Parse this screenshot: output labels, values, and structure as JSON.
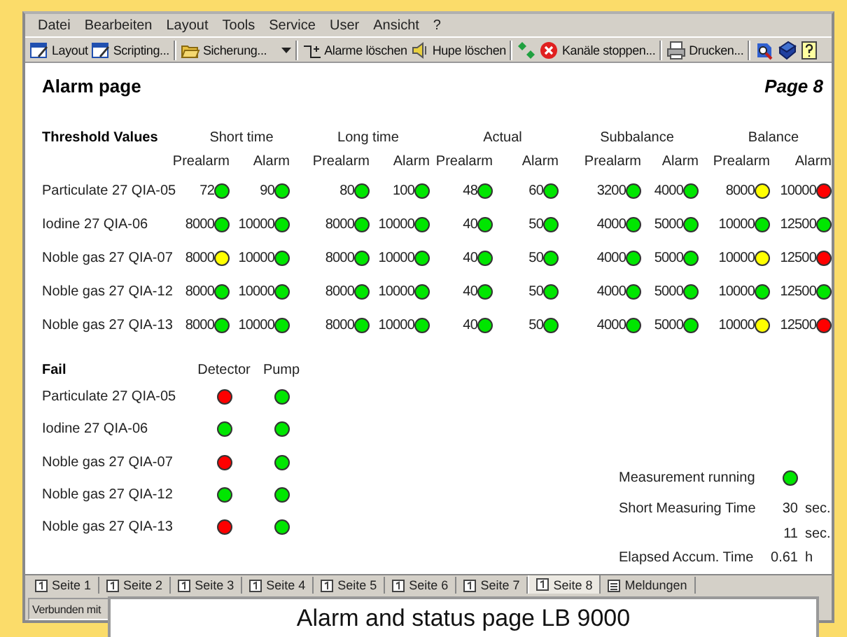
{
  "menu": [
    "Datei",
    "Bearbeiten",
    "Layout",
    "Tools",
    "Service",
    "User",
    "Ansicht",
    "?"
  ],
  "toolbar": [
    {
      "kind": "button",
      "label": "Layout"
    },
    {
      "kind": "button",
      "label": "Scripting..."
    },
    {
      "kind": "separator"
    },
    {
      "kind": "dropdown",
      "label": "Sicherung..."
    },
    {
      "kind": "separator"
    },
    {
      "kind": "button",
      "label": "Alarme löschen"
    },
    {
      "kind": "button",
      "label": "Hupe löschen"
    },
    {
      "kind": "separator"
    },
    {
      "kind": "icon"
    },
    {
      "kind": "button",
      "label": "Kanäle stoppen..."
    },
    {
      "kind": "separator"
    },
    {
      "kind": "button",
      "label": "Drucken..."
    },
    {
      "kind": "separator"
    },
    {
      "kind": "icon"
    },
    {
      "kind": "icon"
    },
    {
      "kind": "icon"
    }
  ],
  "page": {
    "title": "Alarm page",
    "number": "Page 8"
  },
  "threshold": {
    "title": "Threshold Values",
    "groups": [
      {
        "title": "Short time",
        "columns": [
          "Prealarm",
          "Alarm"
        ]
      },
      {
        "title": "Long time",
        "columns": [
          "Prealarm",
          "Alarm"
        ]
      },
      {
        "title": "Actual",
        "columns": [
          "Prealarm",
          "Alarm"
        ]
      },
      {
        "title": "Subbalance",
        "columns": [
          "Prealarm",
          "Alarm"
        ]
      },
      {
        "title": "Balance",
        "columns": [
          "Prealarm",
          "Alarm"
        ]
      }
    ],
    "rows": [
      {
        "name": "Particulate 27 QIA-05",
        "cells": [
          {
            "value": "72",
            "color": "#00e600"
          },
          {
            "value": "90",
            "color": "#00e600"
          },
          {
            "value": "80",
            "color": "#00e600"
          },
          {
            "value": "100",
            "color": "#00e600"
          },
          {
            "value": "48",
            "color": "#00e600"
          },
          {
            "value": "60",
            "color": "#00e600"
          },
          {
            "value": "3200",
            "color": "#00e600"
          },
          {
            "value": "4000",
            "color": "#00e600"
          },
          {
            "value": "8000",
            "color": "#ffff00"
          },
          {
            "value": "10000",
            "color": "#ff0000"
          }
        ]
      },
      {
        "name": "Iodine 27 QIA-06",
        "cells": [
          {
            "value": "8000",
            "color": "#00e600"
          },
          {
            "value": "10000",
            "color": "#00e600"
          },
          {
            "value": "8000",
            "color": "#00e600"
          },
          {
            "value": "10000",
            "color": "#00e600"
          },
          {
            "value": "40",
            "color": "#00e600"
          },
          {
            "value": "50",
            "color": "#00e600"
          },
          {
            "value": "4000",
            "color": "#00e600"
          },
          {
            "value": "5000",
            "color": "#00e600"
          },
          {
            "value": "10000",
            "color": "#00e600"
          },
          {
            "value": "12500",
            "color": "#00e600"
          }
        ]
      },
      {
        "name": "Noble gas 27 QIA-07",
        "cells": [
          {
            "value": "8000",
            "color": "#ffff00"
          },
          {
            "value": "10000",
            "color": "#00e600"
          },
          {
            "value": "8000",
            "color": "#00e600"
          },
          {
            "value": "10000",
            "color": "#00e600"
          },
          {
            "value": "40",
            "color": "#00e600"
          },
          {
            "value": "50",
            "color": "#00e600"
          },
          {
            "value": "4000",
            "color": "#00e600"
          },
          {
            "value": "5000",
            "color": "#00e600"
          },
          {
            "value": "10000",
            "color": "#ffff00"
          },
          {
            "value": "12500",
            "color": "#ff0000"
          }
        ]
      },
      {
        "name": "Noble gas 27 QIA-12",
        "cells": [
          {
            "value": "8000",
            "color": "#00e600"
          },
          {
            "value": "10000",
            "color": "#00e600"
          },
          {
            "value": "8000",
            "color": "#00e600"
          },
          {
            "value": "10000",
            "color": "#00e600"
          },
          {
            "value": "40",
            "color": "#00e600"
          },
          {
            "value": "50",
            "color": "#00e600"
          },
          {
            "value": "4000",
            "color": "#00e600"
          },
          {
            "value": "5000",
            "color": "#00e600"
          },
          {
            "value": "10000",
            "color": "#00e600"
          },
          {
            "value": "12500",
            "color": "#00e600"
          }
        ]
      },
      {
        "name": "Noble gas 27 QIA-13",
        "cells": [
          {
            "value": "8000",
            "color": "#00e600"
          },
          {
            "value": "10000",
            "color": "#00e600"
          },
          {
            "value": "8000",
            "color": "#00e600"
          },
          {
            "value": "10000",
            "color": "#00e600"
          },
          {
            "value": "40",
            "color": "#00e600"
          },
          {
            "value": "50",
            "color": "#00e600"
          },
          {
            "value": "4000",
            "color": "#00e600"
          },
          {
            "value": "5000",
            "color": "#00e600"
          },
          {
            "value": "10000",
            "color": "#ffff00"
          },
          {
            "value": "12500",
            "color": "#ff0000"
          }
        ]
      }
    ]
  },
  "fail": {
    "title": "Fail",
    "columns": [
      "Detector",
      "Pump"
    ],
    "rows": [
      {
        "name": "Particulate 27 QIA-05",
        "indicators": [
          {
            "color": "#ff0000"
          },
          {
            "color": "#00e600"
          }
        ]
      },
      {
        "name": "Iodine 27 QIA-06",
        "indicators": [
          {
            "color": "#00e600"
          },
          {
            "color": "#00e600"
          }
        ]
      },
      {
        "name": "Noble gas 27 QIA-07",
        "indicators": [
          {
            "color": "#ff0000"
          },
          {
            "color": "#00e600"
          }
        ]
      },
      {
        "name": "Noble gas 27 QIA-12",
        "indicators": [
          {
            "color": "#00e600"
          },
          {
            "color": "#00e600"
          }
        ]
      },
      {
        "name": "Noble gas 27 QIA-13",
        "indicators": [
          {
            "color": "#ff0000"
          },
          {
            "color": "#00e600"
          }
        ]
      }
    ]
  },
  "status": {
    "running": {
      "label": "Measurement running",
      "color": "#00e600"
    },
    "times": [
      {
        "label": "Short Measuring Time",
        "value": "30",
        "unit": "sec."
      },
      {
        "value": "11",
        "unit": "sec."
      },
      {
        "label": "Elapsed Accum. Time",
        "value": "0.61",
        "unit": "h"
      }
    ]
  },
  "tabs": [
    {
      "label": "Seite 1",
      "selected": false
    },
    {
      "label": "Seite 2",
      "selected": false
    },
    {
      "label": "Seite 3",
      "selected": false
    },
    {
      "label": "Seite 4",
      "selected": false
    },
    {
      "label": "Seite 5",
      "selected": false
    },
    {
      "label": "Seite 6",
      "selected": false
    },
    {
      "label": "Seite 7",
      "selected": false
    },
    {
      "label": "Seite 8",
      "selected": true
    },
    {
      "label": "Meldungen",
      "selected": false
    }
  ],
  "status_bar": "Verbunden mit",
  "caption": "Alarm and status page LB 9000"
}
